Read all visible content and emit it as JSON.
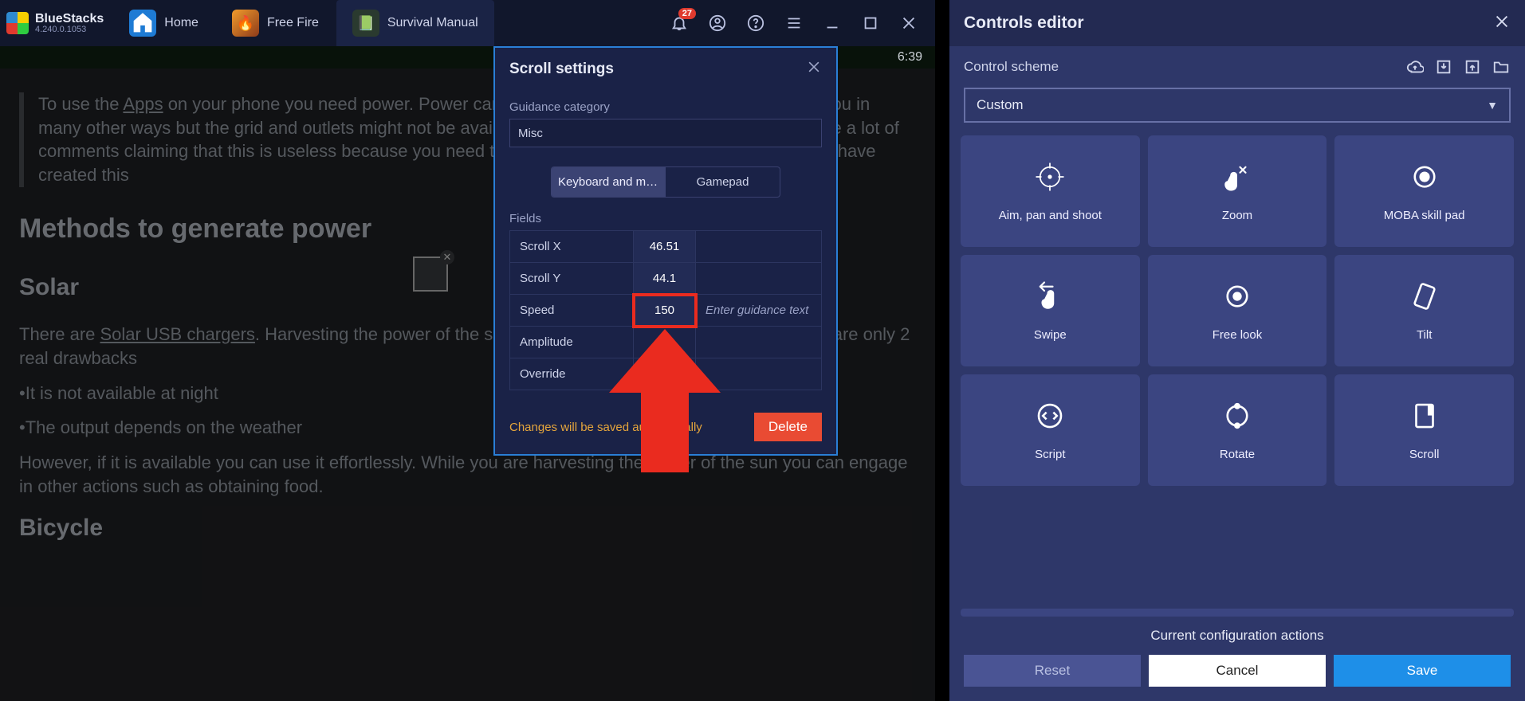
{
  "app": {
    "name": "BlueStacks",
    "version": "4.240.0.1053"
  },
  "tabs": [
    {
      "label": "Home"
    },
    {
      "label": "Free Fire"
    },
    {
      "label": "Survival Manual"
    }
  ],
  "notify_count": "27",
  "status_time": "6:39",
  "article": {
    "intro": "To use the Apps on your phone you need power. Power can also provide you with light and empower you in many other ways but the grid and outlets might not be available. In the early days of this app there were a lot of comments claiming that this is useless because you need to have access to grid power. I disagree and have created this",
    "intro_link": "Apps",
    "h1": "Methods to generate power",
    "h2a": "Solar",
    "p1a": "There are ",
    "p1link": "Solar USB chargers",
    "p1b": ". Harvesting the power of the sun is a clean way to generate power. There are only 2 real drawbacks",
    "b1": "•It is not available at night",
    "b2": "•The output depends on the weather",
    "p2": "However, if it is available you can use it effortlessly. While you are harvesting the power of the sun you can engage in other actions such as obtaining food.",
    "h2b": "Bicycle"
  },
  "modal": {
    "title": "Scroll settings",
    "guidance_label": "Guidance category",
    "guidance_value": "Misc",
    "seg_a": "Keyboard and mo...",
    "seg_b": "Gamepad",
    "fields_label": "Fields",
    "rows": {
      "scrollx": {
        "label": "Scroll X",
        "value": "46.51"
      },
      "scrolly": {
        "label": "Scroll Y",
        "value": "44.1"
      },
      "speed": {
        "label": "Speed",
        "value": "150",
        "guide": "Enter guidance text"
      },
      "amplitude": {
        "label": "Amplitude",
        "value": ""
      },
      "override": {
        "label": "Override",
        "value": ""
      }
    },
    "autosave": "Changes will be saved automatically",
    "delete": "Delete"
  },
  "panel": {
    "title": "Controls editor",
    "sublabel": "Control scheme",
    "scheme": "Custom",
    "tiles": [
      {
        "label": "Aim, pan and shoot",
        "icon": "crosshair"
      },
      {
        "label": "Zoom",
        "icon": "pinch"
      },
      {
        "label": "MOBA skill pad",
        "icon": "ring"
      },
      {
        "label": "Swipe",
        "icon": "swipe"
      },
      {
        "label": "Free look",
        "icon": "eye"
      },
      {
        "label": "Tilt",
        "icon": "tilt"
      },
      {
        "label": "Script",
        "icon": "code"
      },
      {
        "label": "Rotate",
        "icon": "rotate"
      },
      {
        "label": "Scroll",
        "icon": "scroll"
      }
    ],
    "cca": "Current configuration actions",
    "reset": "Reset",
    "cancel": "Cancel",
    "save": "Save"
  }
}
